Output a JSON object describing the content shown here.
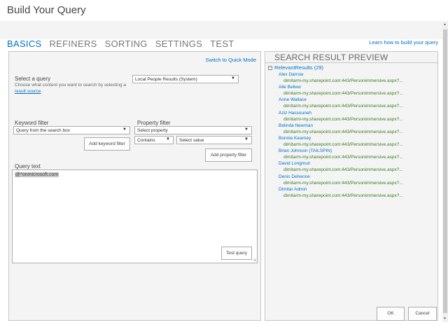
{
  "dialog": {
    "title": "Build Your Query"
  },
  "tabs": [
    {
      "label": "BASICS",
      "active": true
    },
    {
      "label": "REFINERS",
      "active": false
    },
    {
      "label": "SORTING",
      "active": false
    },
    {
      "label": "SETTINGS",
      "active": false
    },
    {
      "label": "TEST",
      "active": false
    }
  ],
  "learn_link": "Learn how to build your query",
  "left": {
    "quick_mode": "Switch to Quick Mode",
    "select_query": {
      "label": "Select a query",
      "help_prefix": "Choose what content you want to search by selecting a ",
      "help_link": "result source",
      "help_suffix": ".",
      "value": "Local People Results (System)"
    },
    "keyword_filter": {
      "label": "Keyword filter",
      "value": "Query from the search box",
      "button": "Add keyword filter"
    },
    "property_filter": {
      "label": "Property filter",
      "property_value": "Select property",
      "operator_value": "Contains",
      "value_value": "Select value",
      "button": "Add property filter"
    },
    "query_text": {
      "label": "Query text",
      "value": "@*onmicrosoft.com"
    },
    "test_button": "Test query"
  },
  "preview": {
    "title": "SEARCH RESULT PREVIEW",
    "group_label": "RelevantResults (29)",
    "results": [
      {
        "name": "Alex Darrow",
        "url": "dimitarm-my.sharepoint.com:443/Personimmersive.aspx?..."
      },
      {
        "name": "Alle Bellew",
        "url": "dimitarm-my.sharepoint.com:443/Personimmersive.aspx?..."
      },
      {
        "name": "Anne Wallace",
        "url": "dimitarm-my.sharepoint.com:443/Personimmersive.aspx?..."
      },
      {
        "name": "Aziz Hassouneh",
        "url": "dimitarm-my.sharepoint.com:443/Personimmersive.aspx?..."
      },
      {
        "name": "Belinda Newman",
        "url": "dimitarm-my.sharepoint.com:443/Personimmersive.aspx?..."
      },
      {
        "name": "Bonnie Kearney",
        "url": "dimitarm-my.sharepoint.com:443/Personimmersive.aspx?..."
      },
      {
        "name": "Brian Johnson (TAILSPIN)",
        "url": "dimitarm-my.sharepoint.com:443/Personimmersive.aspx?..."
      },
      {
        "name": "David Longmuir",
        "url": "dimitarm-my.sharepoint.com:443/Personimmersive.aspx?..."
      },
      {
        "name": "Denis Dehenne",
        "url": "dimitarm-my.sharepoint.com:443/Personimmersive.aspx?..."
      },
      {
        "name": "Dimitar Admin",
        "url": "dimitarm-my.sharepoint.com:443/Personimmersive.aspx?..."
      }
    ]
  },
  "footer": {
    "ok": "OK",
    "cancel": "Cancel"
  },
  "colors": {
    "accent": "#0072c6",
    "url_green": "#3a7a20",
    "panel_bg": "#f4f4f4",
    "border": "#c6c6c6"
  },
  "icons": {
    "dropdown": "chevron-down-icon",
    "collapse": "minus-box-icon",
    "resize": "resize-grip-icon"
  }
}
